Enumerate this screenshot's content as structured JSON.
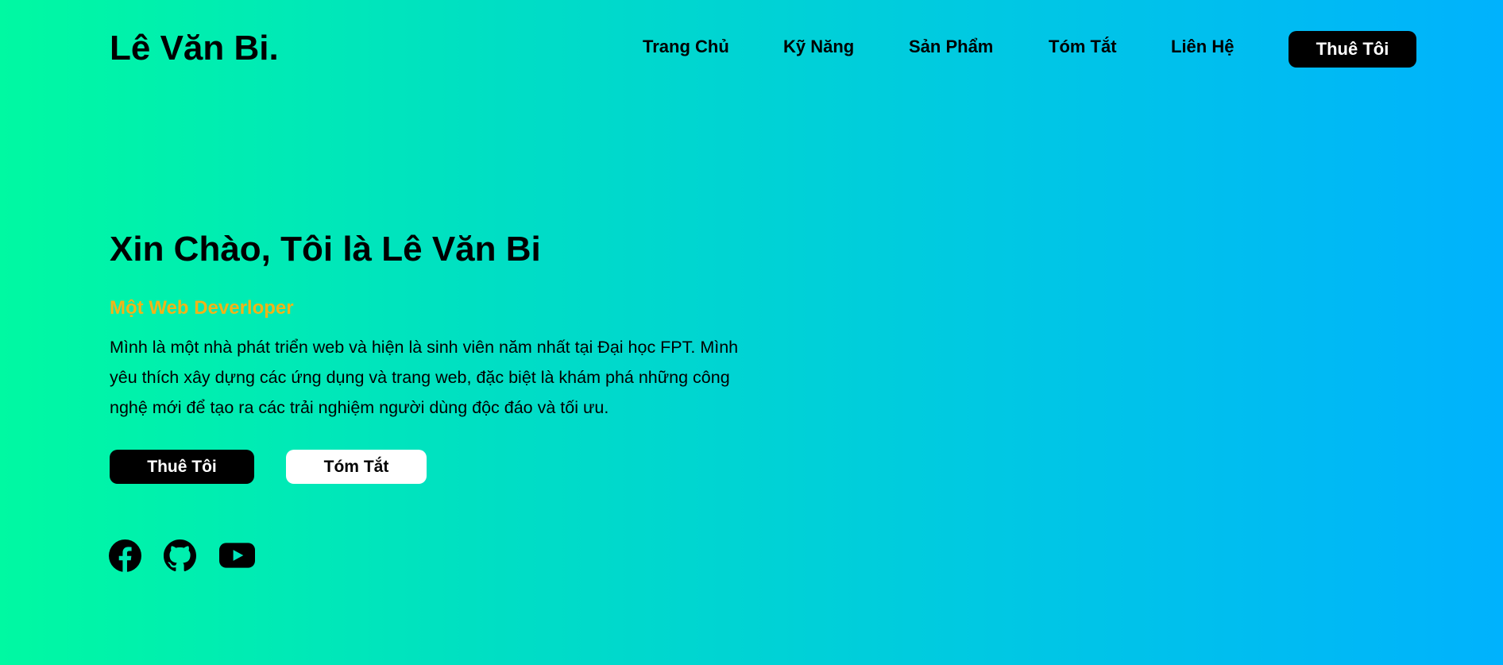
{
  "header": {
    "logo": "Lê Văn Bi.",
    "nav": [
      {
        "label": "Trang Chủ"
      },
      {
        "label": "Kỹ Năng"
      },
      {
        "label": "Sản Phẩm"
      },
      {
        "label": "Tóm Tắt"
      },
      {
        "label": "Liên Hệ"
      }
    ],
    "hire_button": "Thuê Tôi"
  },
  "hero": {
    "title": "Xin Chào, Tôi là Lê Văn Bi",
    "subtitle": "Một Web Deverloper",
    "description": "Mình là một nhà phát triển web và hiện là sinh viên năm nhất tại Đại học FPT. Mình yêu thích xây dựng các ứng dụng và trang web, đặc biệt là khám phá những công nghệ mới để tạo ra các trải nghiệm người dùng độc đáo và tối ưu.",
    "buttons": {
      "hire": "Thuê Tôi",
      "summary": "Tóm Tắt"
    }
  },
  "social": [
    {
      "icon": "facebook-icon"
    },
    {
      "icon": "github-icon"
    },
    {
      "icon": "youtube-icon"
    }
  ],
  "colors": {
    "gradient_start": "#00f9a2",
    "gradient_end": "#00b2fd",
    "subtitle": "#f2b418",
    "primary_button": "#000000",
    "secondary_button": "#ffffff"
  }
}
